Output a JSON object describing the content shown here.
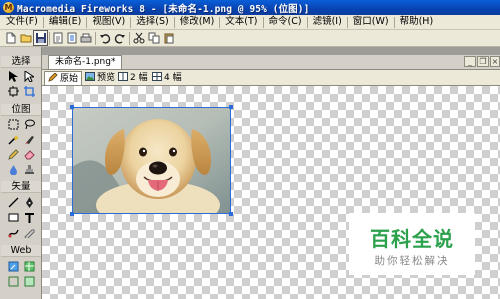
{
  "window": {
    "title": "Macromedia Fireworks 8 - [未命名-1.png @ 95% (位图)]",
    "app_icon_letter": "M"
  },
  "menu": {
    "items": [
      "文件(F)",
      "编辑(E)",
      "视图(V)",
      "选择(S)",
      "修改(M)",
      "文本(T)",
      "命令(C)",
      "滤镜(I)",
      "窗口(W)",
      "帮助(H)"
    ]
  },
  "toolbar": {
    "icons": [
      "new-file-icon",
      "open-file-icon",
      "save-icon",
      "import-icon",
      "export-icon",
      "print-icon",
      "undo-icon",
      "redo-icon",
      "cut-icon",
      "copy-icon",
      "paste-icon"
    ]
  },
  "tools": {
    "sections": [
      "选择",
      "位图",
      "矢量",
      "Web"
    ]
  },
  "document": {
    "tab_label": "未命名-1.png*",
    "views": [
      "原始",
      "预览",
      "2 幅",
      "4 幅"
    ]
  },
  "watermark": {
    "title": "百科全说",
    "subtitle": "助你轻松解决"
  },
  "colors": {
    "title_bar": "#0845b5",
    "selection": "#2b6cd8",
    "watermark_green": "#2ba14c"
  }
}
